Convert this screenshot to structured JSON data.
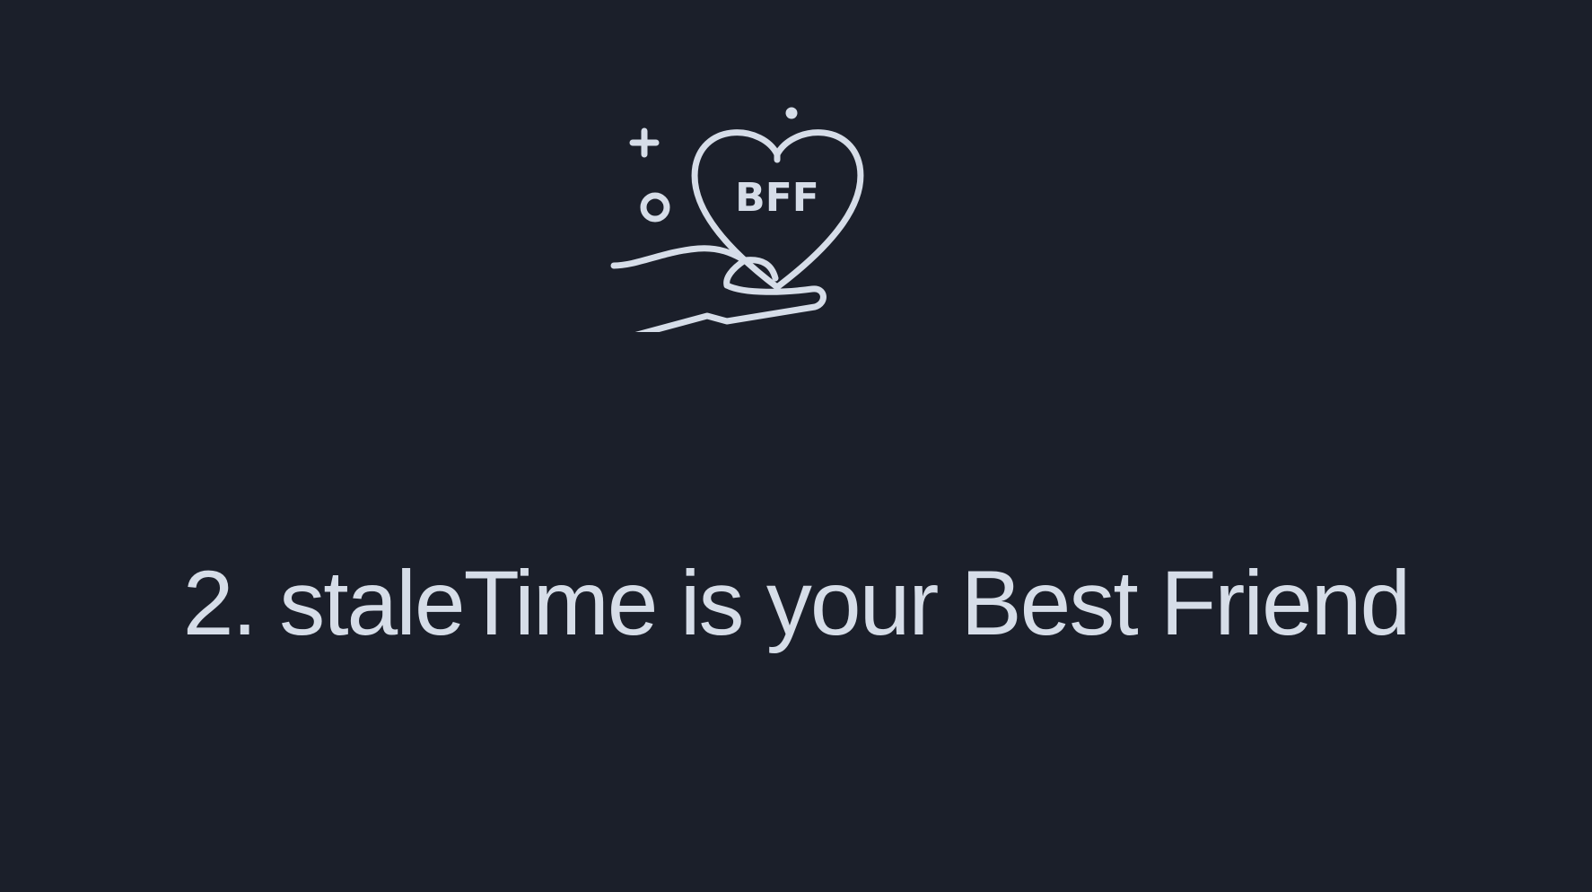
{
  "slide": {
    "icon": {
      "name": "heart-in-hand-icon",
      "badge_text": "BFF",
      "stroke_color": "#d6dde8"
    },
    "title": "2. staleTime is your Best Friend",
    "background_color": "#1b1f2a",
    "text_color": "#d6dde8"
  }
}
